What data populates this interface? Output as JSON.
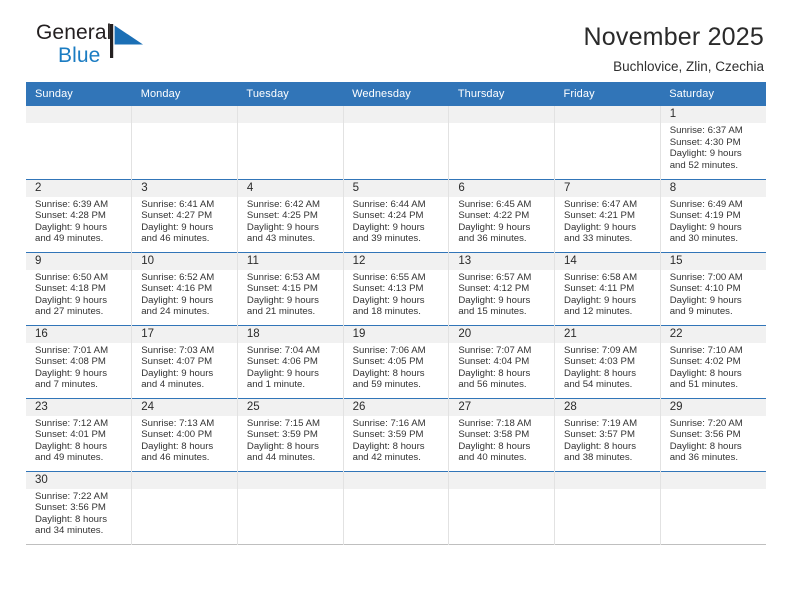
{
  "brand": {
    "line1": "General",
    "line2": "Blue",
    "flag_icon": "blue-triangle-flag-icon",
    "color_dark": "#231f20",
    "color_blue": "#1b7cc2"
  },
  "header": {
    "title": "November 2025",
    "subtitle": "Buchlovice, Zlin, Czechia"
  },
  "theme": {
    "header_blue": "#3175b8",
    "date_band_gray": "#f1f1f1",
    "row_divider": "#3175b8",
    "cell_divider": "#e2e2e2"
  },
  "weekdays": [
    "Sunday",
    "Monday",
    "Tuesday",
    "Wednesday",
    "Thursday",
    "Friday",
    "Saturday"
  ],
  "labels": {
    "sunrise_prefix": "Sunrise:",
    "sunset_prefix": "Sunset:",
    "daylight_prefix": "Daylight:"
  },
  "weeks": [
    [
      {
        "day": "",
        "sunrise": "",
        "sunset": "",
        "daylight_line1": "",
        "daylight_line2": ""
      },
      {
        "day": "",
        "sunrise": "",
        "sunset": "",
        "daylight_line1": "",
        "daylight_line2": ""
      },
      {
        "day": "",
        "sunrise": "",
        "sunset": "",
        "daylight_line1": "",
        "daylight_line2": ""
      },
      {
        "day": "",
        "sunrise": "",
        "sunset": "",
        "daylight_line1": "",
        "daylight_line2": ""
      },
      {
        "day": "",
        "sunrise": "",
        "sunset": "",
        "daylight_line1": "",
        "daylight_line2": ""
      },
      {
        "day": "",
        "sunrise": "",
        "sunset": "",
        "daylight_line1": "",
        "daylight_line2": ""
      },
      {
        "day": "1",
        "sunrise": "Sunrise: 6:37 AM",
        "sunset": "Sunset: 4:30 PM",
        "daylight_line1": "Daylight: 9 hours",
        "daylight_line2": "and 52 minutes."
      }
    ],
    [
      {
        "day": "2",
        "sunrise": "Sunrise: 6:39 AM",
        "sunset": "Sunset: 4:28 PM",
        "daylight_line1": "Daylight: 9 hours",
        "daylight_line2": "and 49 minutes."
      },
      {
        "day": "3",
        "sunrise": "Sunrise: 6:41 AM",
        "sunset": "Sunset: 4:27 PM",
        "daylight_line1": "Daylight: 9 hours",
        "daylight_line2": "and 46 minutes."
      },
      {
        "day": "4",
        "sunrise": "Sunrise: 6:42 AM",
        "sunset": "Sunset: 4:25 PM",
        "daylight_line1": "Daylight: 9 hours",
        "daylight_line2": "and 43 minutes."
      },
      {
        "day": "5",
        "sunrise": "Sunrise: 6:44 AM",
        "sunset": "Sunset: 4:24 PM",
        "daylight_line1": "Daylight: 9 hours",
        "daylight_line2": "and 39 minutes."
      },
      {
        "day": "6",
        "sunrise": "Sunrise: 6:45 AM",
        "sunset": "Sunset: 4:22 PM",
        "daylight_line1": "Daylight: 9 hours",
        "daylight_line2": "and 36 minutes."
      },
      {
        "day": "7",
        "sunrise": "Sunrise: 6:47 AM",
        "sunset": "Sunset: 4:21 PM",
        "daylight_line1": "Daylight: 9 hours",
        "daylight_line2": "and 33 minutes."
      },
      {
        "day": "8",
        "sunrise": "Sunrise: 6:49 AM",
        "sunset": "Sunset: 4:19 PM",
        "daylight_line1": "Daylight: 9 hours",
        "daylight_line2": "and 30 minutes."
      }
    ],
    [
      {
        "day": "9",
        "sunrise": "Sunrise: 6:50 AM",
        "sunset": "Sunset: 4:18 PM",
        "daylight_line1": "Daylight: 9 hours",
        "daylight_line2": "and 27 minutes."
      },
      {
        "day": "10",
        "sunrise": "Sunrise: 6:52 AM",
        "sunset": "Sunset: 4:16 PM",
        "daylight_line1": "Daylight: 9 hours",
        "daylight_line2": "and 24 minutes."
      },
      {
        "day": "11",
        "sunrise": "Sunrise: 6:53 AM",
        "sunset": "Sunset: 4:15 PM",
        "daylight_line1": "Daylight: 9 hours",
        "daylight_line2": "and 21 minutes."
      },
      {
        "day": "12",
        "sunrise": "Sunrise: 6:55 AM",
        "sunset": "Sunset: 4:13 PM",
        "daylight_line1": "Daylight: 9 hours",
        "daylight_line2": "and 18 minutes."
      },
      {
        "day": "13",
        "sunrise": "Sunrise: 6:57 AM",
        "sunset": "Sunset: 4:12 PM",
        "daylight_line1": "Daylight: 9 hours",
        "daylight_line2": "and 15 minutes."
      },
      {
        "day": "14",
        "sunrise": "Sunrise: 6:58 AM",
        "sunset": "Sunset: 4:11 PM",
        "daylight_line1": "Daylight: 9 hours",
        "daylight_line2": "and 12 minutes."
      },
      {
        "day": "15",
        "sunrise": "Sunrise: 7:00 AM",
        "sunset": "Sunset: 4:10 PM",
        "daylight_line1": "Daylight: 9 hours",
        "daylight_line2": "and 9 minutes."
      }
    ],
    [
      {
        "day": "16",
        "sunrise": "Sunrise: 7:01 AM",
        "sunset": "Sunset: 4:08 PM",
        "daylight_line1": "Daylight: 9 hours",
        "daylight_line2": "and 7 minutes."
      },
      {
        "day": "17",
        "sunrise": "Sunrise: 7:03 AM",
        "sunset": "Sunset: 4:07 PM",
        "daylight_line1": "Daylight: 9 hours",
        "daylight_line2": "and 4 minutes."
      },
      {
        "day": "18",
        "sunrise": "Sunrise: 7:04 AM",
        "sunset": "Sunset: 4:06 PM",
        "daylight_line1": "Daylight: 9 hours",
        "daylight_line2": "and 1 minute."
      },
      {
        "day": "19",
        "sunrise": "Sunrise: 7:06 AM",
        "sunset": "Sunset: 4:05 PM",
        "daylight_line1": "Daylight: 8 hours",
        "daylight_line2": "and 59 minutes."
      },
      {
        "day": "20",
        "sunrise": "Sunrise: 7:07 AM",
        "sunset": "Sunset: 4:04 PM",
        "daylight_line1": "Daylight: 8 hours",
        "daylight_line2": "and 56 minutes."
      },
      {
        "day": "21",
        "sunrise": "Sunrise: 7:09 AM",
        "sunset": "Sunset: 4:03 PM",
        "daylight_line1": "Daylight: 8 hours",
        "daylight_line2": "and 54 minutes."
      },
      {
        "day": "22",
        "sunrise": "Sunrise: 7:10 AM",
        "sunset": "Sunset: 4:02 PM",
        "daylight_line1": "Daylight: 8 hours",
        "daylight_line2": "and 51 minutes."
      }
    ],
    [
      {
        "day": "23",
        "sunrise": "Sunrise: 7:12 AM",
        "sunset": "Sunset: 4:01 PM",
        "daylight_line1": "Daylight: 8 hours",
        "daylight_line2": "and 49 minutes."
      },
      {
        "day": "24",
        "sunrise": "Sunrise: 7:13 AM",
        "sunset": "Sunset: 4:00 PM",
        "daylight_line1": "Daylight: 8 hours",
        "daylight_line2": "and 46 minutes."
      },
      {
        "day": "25",
        "sunrise": "Sunrise: 7:15 AM",
        "sunset": "Sunset: 3:59 PM",
        "daylight_line1": "Daylight: 8 hours",
        "daylight_line2": "and 44 minutes."
      },
      {
        "day": "26",
        "sunrise": "Sunrise: 7:16 AM",
        "sunset": "Sunset: 3:59 PM",
        "daylight_line1": "Daylight: 8 hours",
        "daylight_line2": "and 42 minutes."
      },
      {
        "day": "27",
        "sunrise": "Sunrise: 7:18 AM",
        "sunset": "Sunset: 3:58 PM",
        "daylight_line1": "Daylight: 8 hours",
        "daylight_line2": "and 40 minutes."
      },
      {
        "day": "28",
        "sunrise": "Sunrise: 7:19 AM",
        "sunset": "Sunset: 3:57 PM",
        "daylight_line1": "Daylight: 8 hours",
        "daylight_line2": "and 38 minutes."
      },
      {
        "day": "29",
        "sunrise": "Sunrise: 7:20 AM",
        "sunset": "Sunset: 3:56 PM",
        "daylight_line1": "Daylight: 8 hours",
        "daylight_line2": "and 36 minutes."
      }
    ],
    [
      {
        "day": "30",
        "sunrise": "Sunrise: 7:22 AM",
        "sunset": "Sunset: 3:56 PM",
        "daylight_line1": "Daylight: 8 hours",
        "daylight_line2": "and 34 minutes."
      },
      {
        "day": "",
        "sunrise": "",
        "sunset": "",
        "daylight_line1": "",
        "daylight_line2": ""
      },
      {
        "day": "",
        "sunrise": "",
        "sunset": "",
        "daylight_line1": "",
        "daylight_line2": ""
      },
      {
        "day": "",
        "sunrise": "",
        "sunset": "",
        "daylight_line1": "",
        "daylight_line2": ""
      },
      {
        "day": "",
        "sunrise": "",
        "sunset": "",
        "daylight_line1": "",
        "daylight_line2": ""
      },
      {
        "day": "",
        "sunrise": "",
        "sunset": "",
        "daylight_line1": "",
        "daylight_line2": ""
      },
      {
        "day": "",
        "sunrise": "",
        "sunset": "",
        "daylight_line1": "",
        "daylight_line2": ""
      }
    ]
  ]
}
